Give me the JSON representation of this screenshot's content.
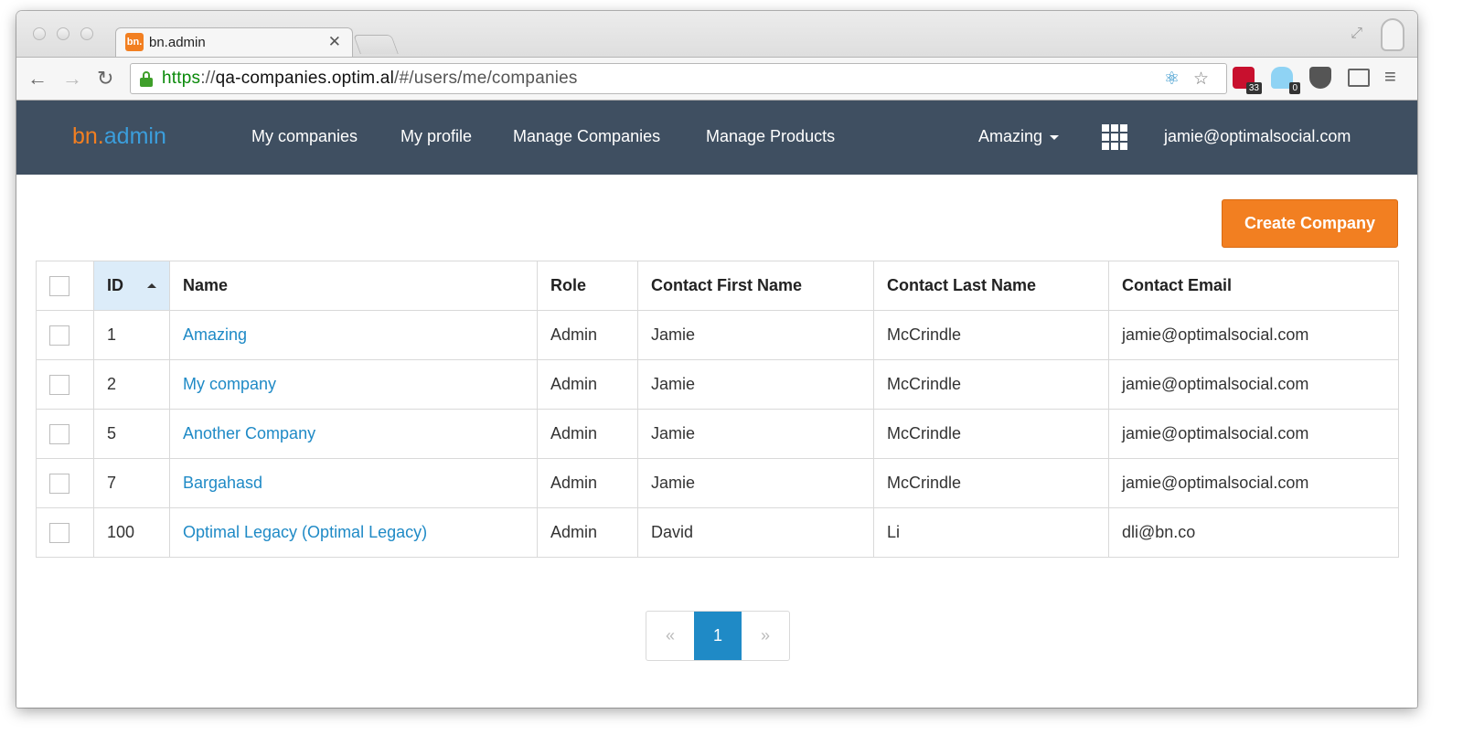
{
  "browser": {
    "tab_title": "bn.admin",
    "favicon_text": "bn.",
    "close_glyph": "✕",
    "url_scheme": "https",
    "url_sep": "://",
    "url_host": "qa-companies.optim.al",
    "url_path": "/#/users/me/companies",
    "nav_icons": [
      "back-arrow-icon",
      "forward-arrow-icon",
      "reload-icon"
    ],
    "extensions": [
      {
        "name": "lastpass-icon",
        "badge": "33",
        "color": "#c8102e"
      },
      {
        "name": "ghostery-icon",
        "badge": "0",
        "color": "#1ba1e2"
      },
      {
        "name": "pocket-icon",
        "badge": "",
        "color": "#555555"
      }
    ]
  },
  "app": {
    "brand_bn": "bn.",
    "brand_admin": "admin",
    "nav_links": [
      "My companies",
      "My profile",
      "Manage Companies",
      "Manage Products"
    ],
    "company_dropdown": "Amazing",
    "user_email": "jamie@optimalsocial.com",
    "colors": {
      "navbar": "#3f4f61",
      "accent": "#f27f21",
      "link": "#1f8ac6"
    }
  },
  "toolbar": {
    "create_label": "Create Company"
  },
  "table": {
    "columns": [
      "ID",
      "Name",
      "Role",
      "Contact First Name",
      "Contact Last Name",
      "Contact Email"
    ],
    "sorted_column": "ID",
    "rows": [
      {
        "id": "1",
        "name": "Amazing",
        "role": "Admin",
        "first": "Jamie",
        "last": "McCrindle",
        "email": "jamie@optimalsocial.com"
      },
      {
        "id": "2",
        "name": "My company",
        "role": "Admin",
        "first": "Jamie",
        "last": "McCrindle",
        "email": "jamie@optimalsocial.com"
      },
      {
        "id": "5",
        "name": "Another Company",
        "role": "Admin",
        "first": "Jamie",
        "last": "McCrindle",
        "email": "jamie@optimalsocial.com"
      },
      {
        "id": "7",
        "name": "Bargahasd",
        "role": "Admin",
        "first": "Jamie",
        "last": "McCrindle",
        "email": "jamie@optimalsocial.com"
      },
      {
        "id": "100",
        "name": "Optimal Legacy (Optimal Legacy)",
        "role": "Admin",
        "first": "David",
        "last": "Li",
        "email": "dli@bn.co"
      }
    ]
  },
  "pagination": {
    "prev": "«",
    "current": "1",
    "next": "»"
  }
}
